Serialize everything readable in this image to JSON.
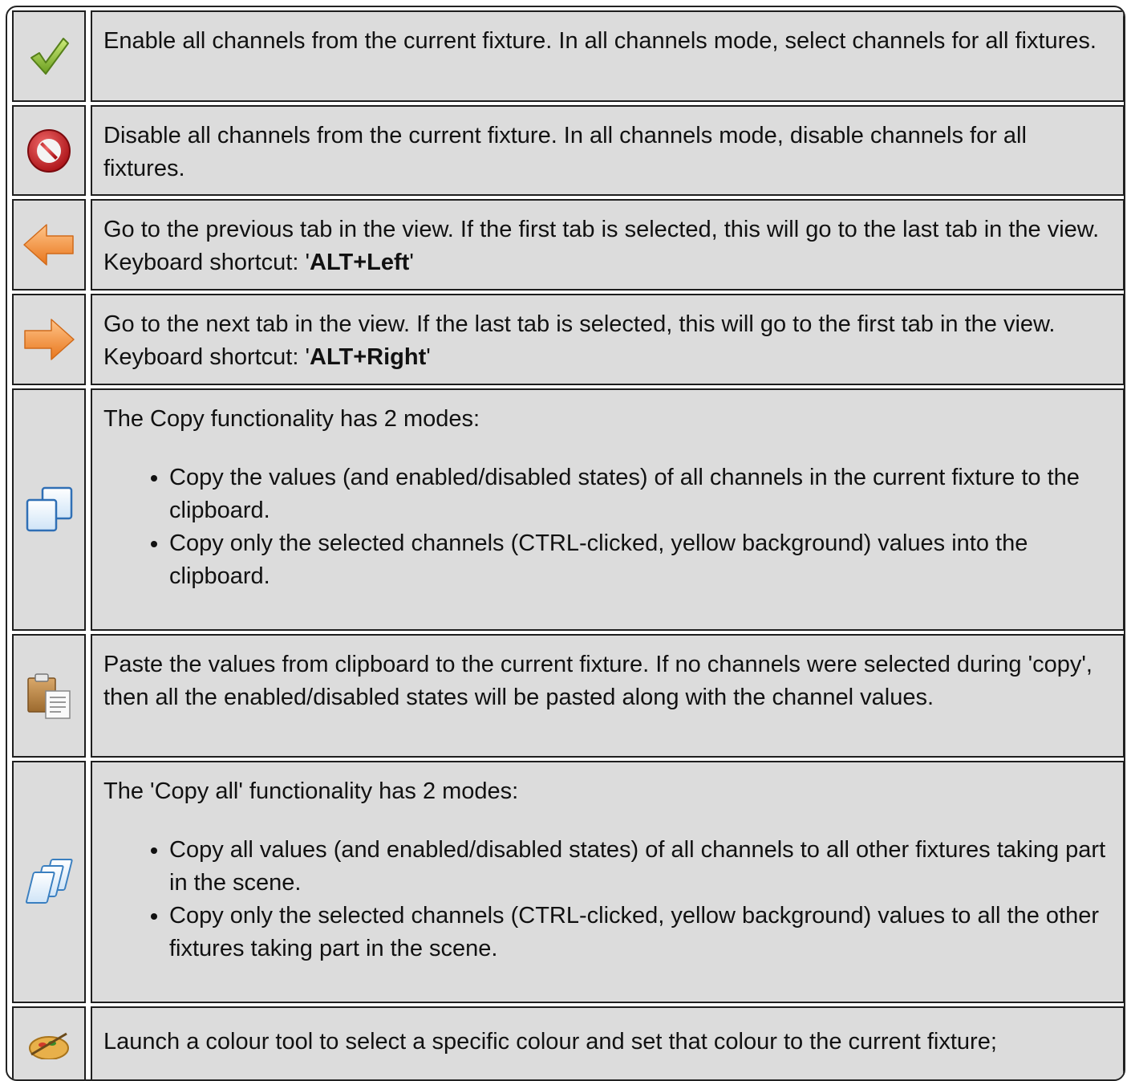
{
  "rows": [
    {
      "icon": "check-icon",
      "text": "Enable all channels from the current fixture. In all channels mode, select channels for all fixtures."
    },
    {
      "icon": "disable-icon",
      "text": "Disable all channels from the current fixture. In all channels mode, disable channels for all fixtures."
    },
    {
      "icon": "arrow-left-icon",
      "text_before": "Go to the previous tab in the view. If the first tab is selected, this will go to the last tab in the view. Keyboard shortcut: '",
      "shortcut": "ALT+Left",
      "text_after": "'"
    },
    {
      "icon": "arrow-right-icon",
      "text_before": "Go to the next tab in the view. If the last tab is selected, this will go to the first tab in the view. Keyboard shortcut: '",
      "shortcut": "ALT+Right",
      "text_after": "'"
    },
    {
      "icon": "copy-icon",
      "intro": "The Copy functionality has 2 modes:",
      "bullets": [
        "Copy the values (and enabled/disabled states) of all channels in the current fixture to the clipboard.",
        "Copy only the selected channels (CTRL-clicked, yellow background) values into the clipboard."
      ]
    },
    {
      "icon": "paste-icon",
      "text": "Paste the values from clipboard to the current fixture. If no channels were selected during 'copy', then all the enabled/disabled states will be pasted along with the channel values."
    },
    {
      "icon": "copy-all-icon",
      "intro": "The 'Copy all' functionality has 2 modes:",
      "bullets": [
        "Copy all values (and enabled/disabled states) of all channels to all other fixtures taking part in the scene.",
        "Copy only the selected channels (CTRL-clicked, yellow background) values to all the other fixtures taking part in the scene."
      ]
    },
    {
      "icon": "color-tool-icon",
      "text": "Launch a colour tool to select a specific colour and set that colour to the current fixture;"
    }
  ],
  "colors": {
    "cell_background": "#dcdcdc",
    "border": "#1e1e1e"
  }
}
